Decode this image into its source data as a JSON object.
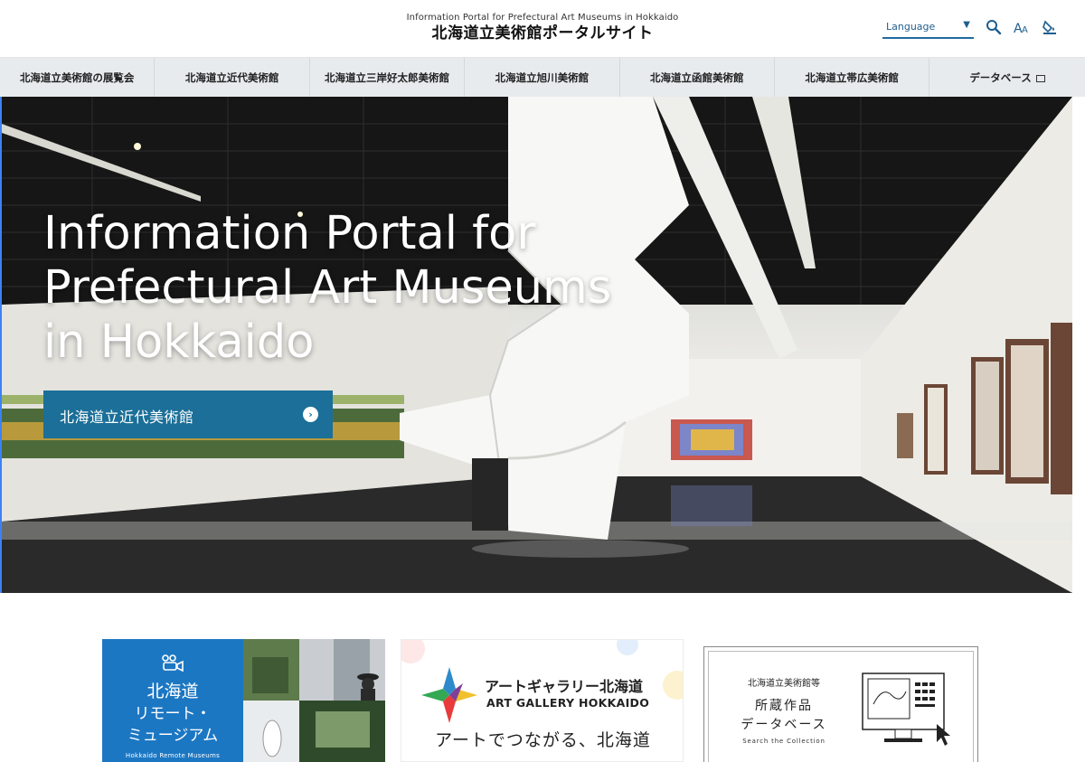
{
  "header": {
    "subtitle": "Information Portal for Prefectural Art Museums in Hokkaido",
    "title": "北海道立美術館ポータルサイト",
    "language_label": "Language",
    "icons": [
      "search-icon",
      "font-size-icon",
      "color-contrast-icon"
    ]
  },
  "nav": {
    "items": [
      {
        "label": "北海道立美術館の展覧会"
      },
      {
        "label": "北海道立近代美術館"
      },
      {
        "label": "北海道立三岸好太郎美術館"
      },
      {
        "label": "北海道立旭川美術館"
      },
      {
        "label": "北海道立函館美術館"
      },
      {
        "label": "北海道立帯広美術館"
      },
      {
        "label": "データベース",
        "external": true
      }
    ]
  },
  "hero": {
    "title_line1": "Information Portal for",
    "title_line2": "Prefectural Art Museums",
    "title_line3": "in Hokkaido",
    "button_label": "北海道立近代美術館"
  },
  "banners": {
    "remote": {
      "title_line1": "北海道",
      "title_line2": "リモート・",
      "title_line3": "ミュージアム",
      "subtitle": "Hokkaido Remote Museums"
    },
    "gallery": {
      "title_jp": "アートギャラリー北海道",
      "title_en": "ART GALLERY HOKKAIDO",
      "tagline": "アートでつながる、北海道"
    },
    "collection": {
      "small": "北海道立美術館等",
      "line1": "所蔵作品",
      "line2": "データベース",
      "en": "Search the Collection"
    }
  },
  "colors": {
    "accent": "#1b6f98",
    "nav_bg": "#e7ebee",
    "remote_blue": "#1c77c3"
  }
}
